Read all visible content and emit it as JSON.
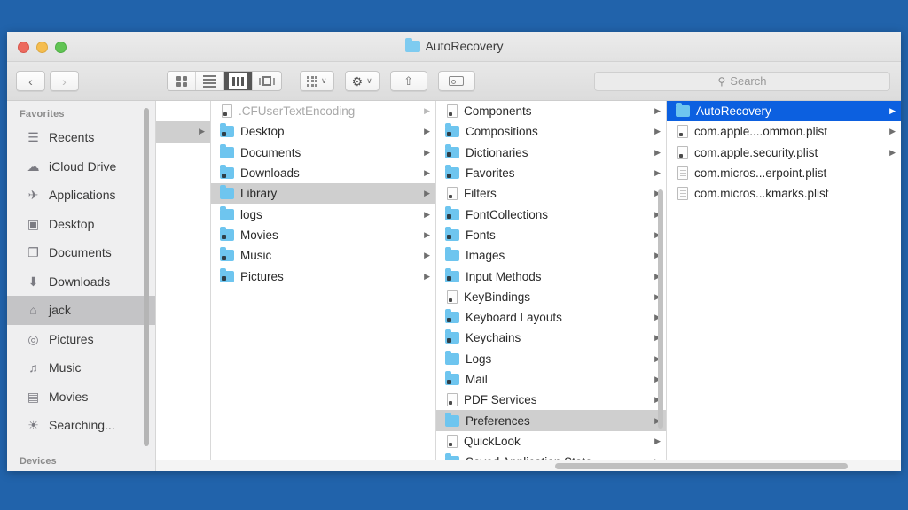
{
  "window": {
    "title": "AutoRecovery",
    "title_icon": "folder-icon",
    "traffic_lights": [
      "close-button",
      "minimize-button",
      "zoom-button"
    ]
  },
  "toolbar": {
    "back_label": "‹",
    "forward_label": "›",
    "view_modes": [
      {
        "name": "icon-view",
        "active": false
      },
      {
        "name": "list-view",
        "active": false
      },
      {
        "name": "column-view",
        "active": true
      },
      {
        "name": "gallery-view",
        "active": false
      }
    ],
    "arrange_label": "∨",
    "action_label": "⚙",
    "action_caret": "∨",
    "share_label": "⇧",
    "tags_label": "tag-icon",
    "search": {
      "icon": "search-icon",
      "placeholder": "Search",
      "value": ""
    }
  },
  "sidebar": {
    "section_favorites": "Favorites",
    "section_devices": "Devices",
    "items": [
      {
        "label": "Recents",
        "icon": "☰",
        "selected": false
      },
      {
        "label": "iCloud Drive",
        "icon": "☁",
        "selected": false
      },
      {
        "label": "Applications",
        "icon": "✈",
        "selected": false
      },
      {
        "label": "Desktop",
        "icon": "▣",
        "selected": false
      },
      {
        "label": "Documents",
        "icon": "❐",
        "selected": false
      },
      {
        "label": "Downloads",
        "icon": "⬇",
        "selected": false
      },
      {
        "label": "jack",
        "icon": "⌂",
        "selected": true
      },
      {
        "label": "Pictures",
        "icon": "◎",
        "selected": false
      },
      {
        "label": "Music",
        "icon": "♫",
        "selected": false
      },
      {
        "label": "Movies",
        "icon": "▤",
        "selected": false
      },
      {
        "label": "Searching...",
        "icon": "☀",
        "selected": false
      }
    ]
  },
  "columns": [
    {
      "name": "column-home-partial",
      "items": [
        {
          "label": "",
          "kind": "blank",
          "arrow": false,
          "selected": false,
          "dim": false
        },
        {
          "label": "",
          "kind": "blank",
          "arrow": true,
          "selected": true,
          "dim": false
        }
      ]
    },
    {
      "name": "column-jack",
      "items": [
        {
          "label": ".CFUserTextEncoding",
          "kind": "doc",
          "arrow": true,
          "selected": false,
          "dim": true
        },
        {
          "label": "Desktop",
          "kind": "folder-badge",
          "arrow": true,
          "selected": false,
          "dim": false
        },
        {
          "label": "Documents",
          "kind": "folder",
          "arrow": true,
          "selected": false,
          "dim": false
        },
        {
          "label": "Downloads",
          "kind": "folder-badge",
          "arrow": true,
          "selected": false,
          "dim": false
        },
        {
          "label": "Library",
          "kind": "folder",
          "arrow": true,
          "selected": true,
          "dim": false
        },
        {
          "label": "logs",
          "kind": "folder",
          "arrow": true,
          "selected": false,
          "dim": false
        },
        {
          "label": "Movies",
          "kind": "folder-badge",
          "arrow": true,
          "selected": false,
          "dim": false
        },
        {
          "label": "Music",
          "kind": "folder-badge",
          "arrow": true,
          "selected": false,
          "dim": false
        },
        {
          "label": "Pictures",
          "kind": "folder-badge",
          "arrow": true,
          "selected": false,
          "dim": false
        }
      ]
    },
    {
      "name": "column-library",
      "items": [
        {
          "label": "Components",
          "kind": "doc-badge",
          "arrow": true,
          "selected": false,
          "dim": false
        },
        {
          "label": "Compositions",
          "kind": "folder-badge",
          "arrow": true,
          "selected": false,
          "dim": false
        },
        {
          "label": "Dictionaries",
          "kind": "folder-badge",
          "arrow": true,
          "selected": false,
          "dim": false
        },
        {
          "label": "Favorites",
          "kind": "folder-badge",
          "arrow": true,
          "selected": false,
          "dim": false
        },
        {
          "label": "Filters",
          "kind": "doc-badge",
          "arrow": true,
          "selected": false,
          "dim": false
        },
        {
          "label": "FontCollections",
          "kind": "folder-badge",
          "arrow": true,
          "selected": false,
          "dim": false
        },
        {
          "label": "Fonts",
          "kind": "folder-badge",
          "arrow": true,
          "selected": false,
          "dim": false
        },
        {
          "label": "Images",
          "kind": "folder",
          "arrow": true,
          "selected": false,
          "dim": false
        },
        {
          "label": "Input Methods",
          "kind": "folder-badge",
          "arrow": true,
          "selected": false,
          "dim": false
        },
        {
          "label": "KeyBindings",
          "kind": "doc-badge",
          "arrow": true,
          "selected": false,
          "dim": false
        },
        {
          "label": "Keyboard Layouts",
          "kind": "folder-badge",
          "arrow": true,
          "selected": false,
          "dim": false
        },
        {
          "label": "Keychains",
          "kind": "folder-badge",
          "arrow": true,
          "selected": false,
          "dim": false
        },
        {
          "label": "Logs",
          "kind": "folder",
          "arrow": true,
          "selected": false,
          "dim": false
        },
        {
          "label": "Mail",
          "kind": "folder-badge",
          "arrow": true,
          "selected": false,
          "dim": false
        },
        {
          "label": "PDF Services",
          "kind": "doc-badge",
          "arrow": true,
          "selected": false,
          "dim": false
        },
        {
          "label": "Preferences",
          "kind": "folder",
          "arrow": true,
          "selected": true,
          "dim": false
        },
        {
          "label": "QuickLook",
          "kind": "doc-badge",
          "arrow": true,
          "selected": false,
          "dim": false
        },
        {
          "label": "Saved Application State",
          "kind": "folder",
          "arrow": true,
          "selected": false,
          "dim": false
        }
      ]
    },
    {
      "name": "column-preferences",
      "items": [
        {
          "label": "AutoRecovery",
          "kind": "folder",
          "arrow": true,
          "selected": true,
          "dim": false
        },
        {
          "label": "com.apple....ommon.plist",
          "kind": "doc-badge",
          "arrow": true,
          "selected": false,
          "dim": false
        },
        {
          "label": "com.apple.security.plist",
          "kind": "doc-badge",
          "arrow": true,
          "selected": false,
          "dim": false
        },
        {
          "label": "com.micros...erpoint.plist",
          "kind": "doc-lines",
          "arrow": false,
          "selected": false,
          "dim": false
        },
        {
          "label": "com.micros...kmarks.plist",
          "kind": "doc-lines",
          "arrow": false,
          "selected": false,
          "dim": false
        }
      ]
    }
  ],
  "colors": {
    "desktop_blue": "#2163ab",
    "selection_blue": "#0c60e0",
    "selection_grey": "#cfcfcf",
    "folder_blue": "#6ec5ef",
    "sidebar_bg": "#efeff0"
  }
}
